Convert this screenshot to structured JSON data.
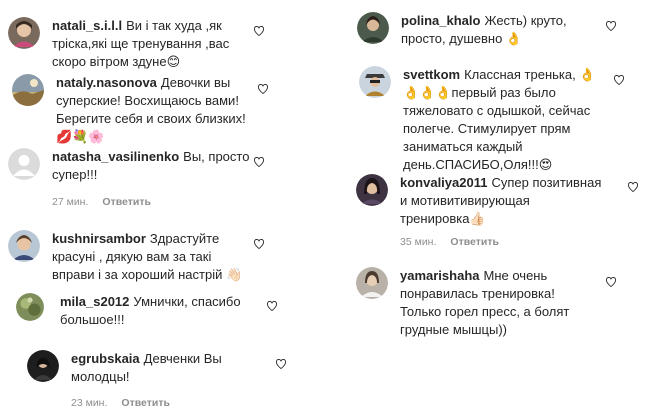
{
  "colors": {
    "text": "#262626",
    "meta": "#8e8e8e",
    "heart_stroke": "#262626"
  },
  "left_comments": [
    {
      "username": "natali_s.i.l.l",
      "text_lines": [
        "Ви і так худа ,як",
        "тріска,які ще тренування ,вас",
        "скоро вітром здуне😊"
      ],
      "avatar_icon": "profile-photo"
    },
    {
      "username": "nataly.nasonova",
      "text_lines": [
        "Девочки вы",
        "суперские! Восхищаюсь вами!",
        "Берегите себя и своих близких!",
        "💋💐🌸"
      ],
      "avatar_icon": "profile-photo"
    },
    {
      "username": "natasha_vasilinenko",
      "text_lines": [
        "Вы, просто",
        "супер!!!"
      ],
      "time": "27 мин.",
      "reply": "Ответить",
      "avatar_icon": "default-avatar"
    },
    {
      "username": "kushnirsambor",
      "text_lines": [
        "Здрастуйте",
        "красуні , дякую вам за такі",
        "вправи і за хороший настрій 👋🏻"
      ],
      "avatar_icon": "profile-photo"
    },
    {
      "username": "mila_s2012",
      "text_lines": [
        "Умнички, спасибо",
        "большое!!!"
      ],
      "avatar_icon": "profile-photo"
    },
    {
      "username": "egrubskaia",
      "text_lines": [
        "Девченки Вы",
        "молодцы!"
      ],
      "time": "23 мин.",
      "reply": "Ответить",
      "avatar_icon": "profile-photo"
    }
  ],
  "right_comments": [
    {
      "username": "polina_khalo",
      "text_lines": [
        "Жесть) круто,",
        "просто, душевно 👌"
      ],
      "avatar_icon": "profile-photo"
    },
    {
      "username": "svettkom",
      "text_lines": [
        "Классная тренька, 👌",
        "👌👌👌первый раз было",
        "тяжеловато с одышкой, сейчас",
        "полегче. Стимулирует прям",
        "заниматься каждый",
        "день.СПАСИБО,Оля!!!😍"
      ],
      "avatar_icon": "profile-photo"
    },
    {
      "username": "konvaliya2011",
      "text_lines": [
        "Супер позитивная",
        "и мотивитивирующая",
        "тренировка👍🏻"
      ],
      "time": "35 мин.",
      "reply": "Ответить",
      "avatar_icon": "profile-photo"
    },
    {
      "username": "yamarishaha",
      "text_lines": [
        "Мне очень",
        "понравилась тренировка!",
        "Только горел пресс, а болят",
        "грудные мышцы))"
      ],
      "avatar_icon": "profile-photo"
    }
  ]
}
